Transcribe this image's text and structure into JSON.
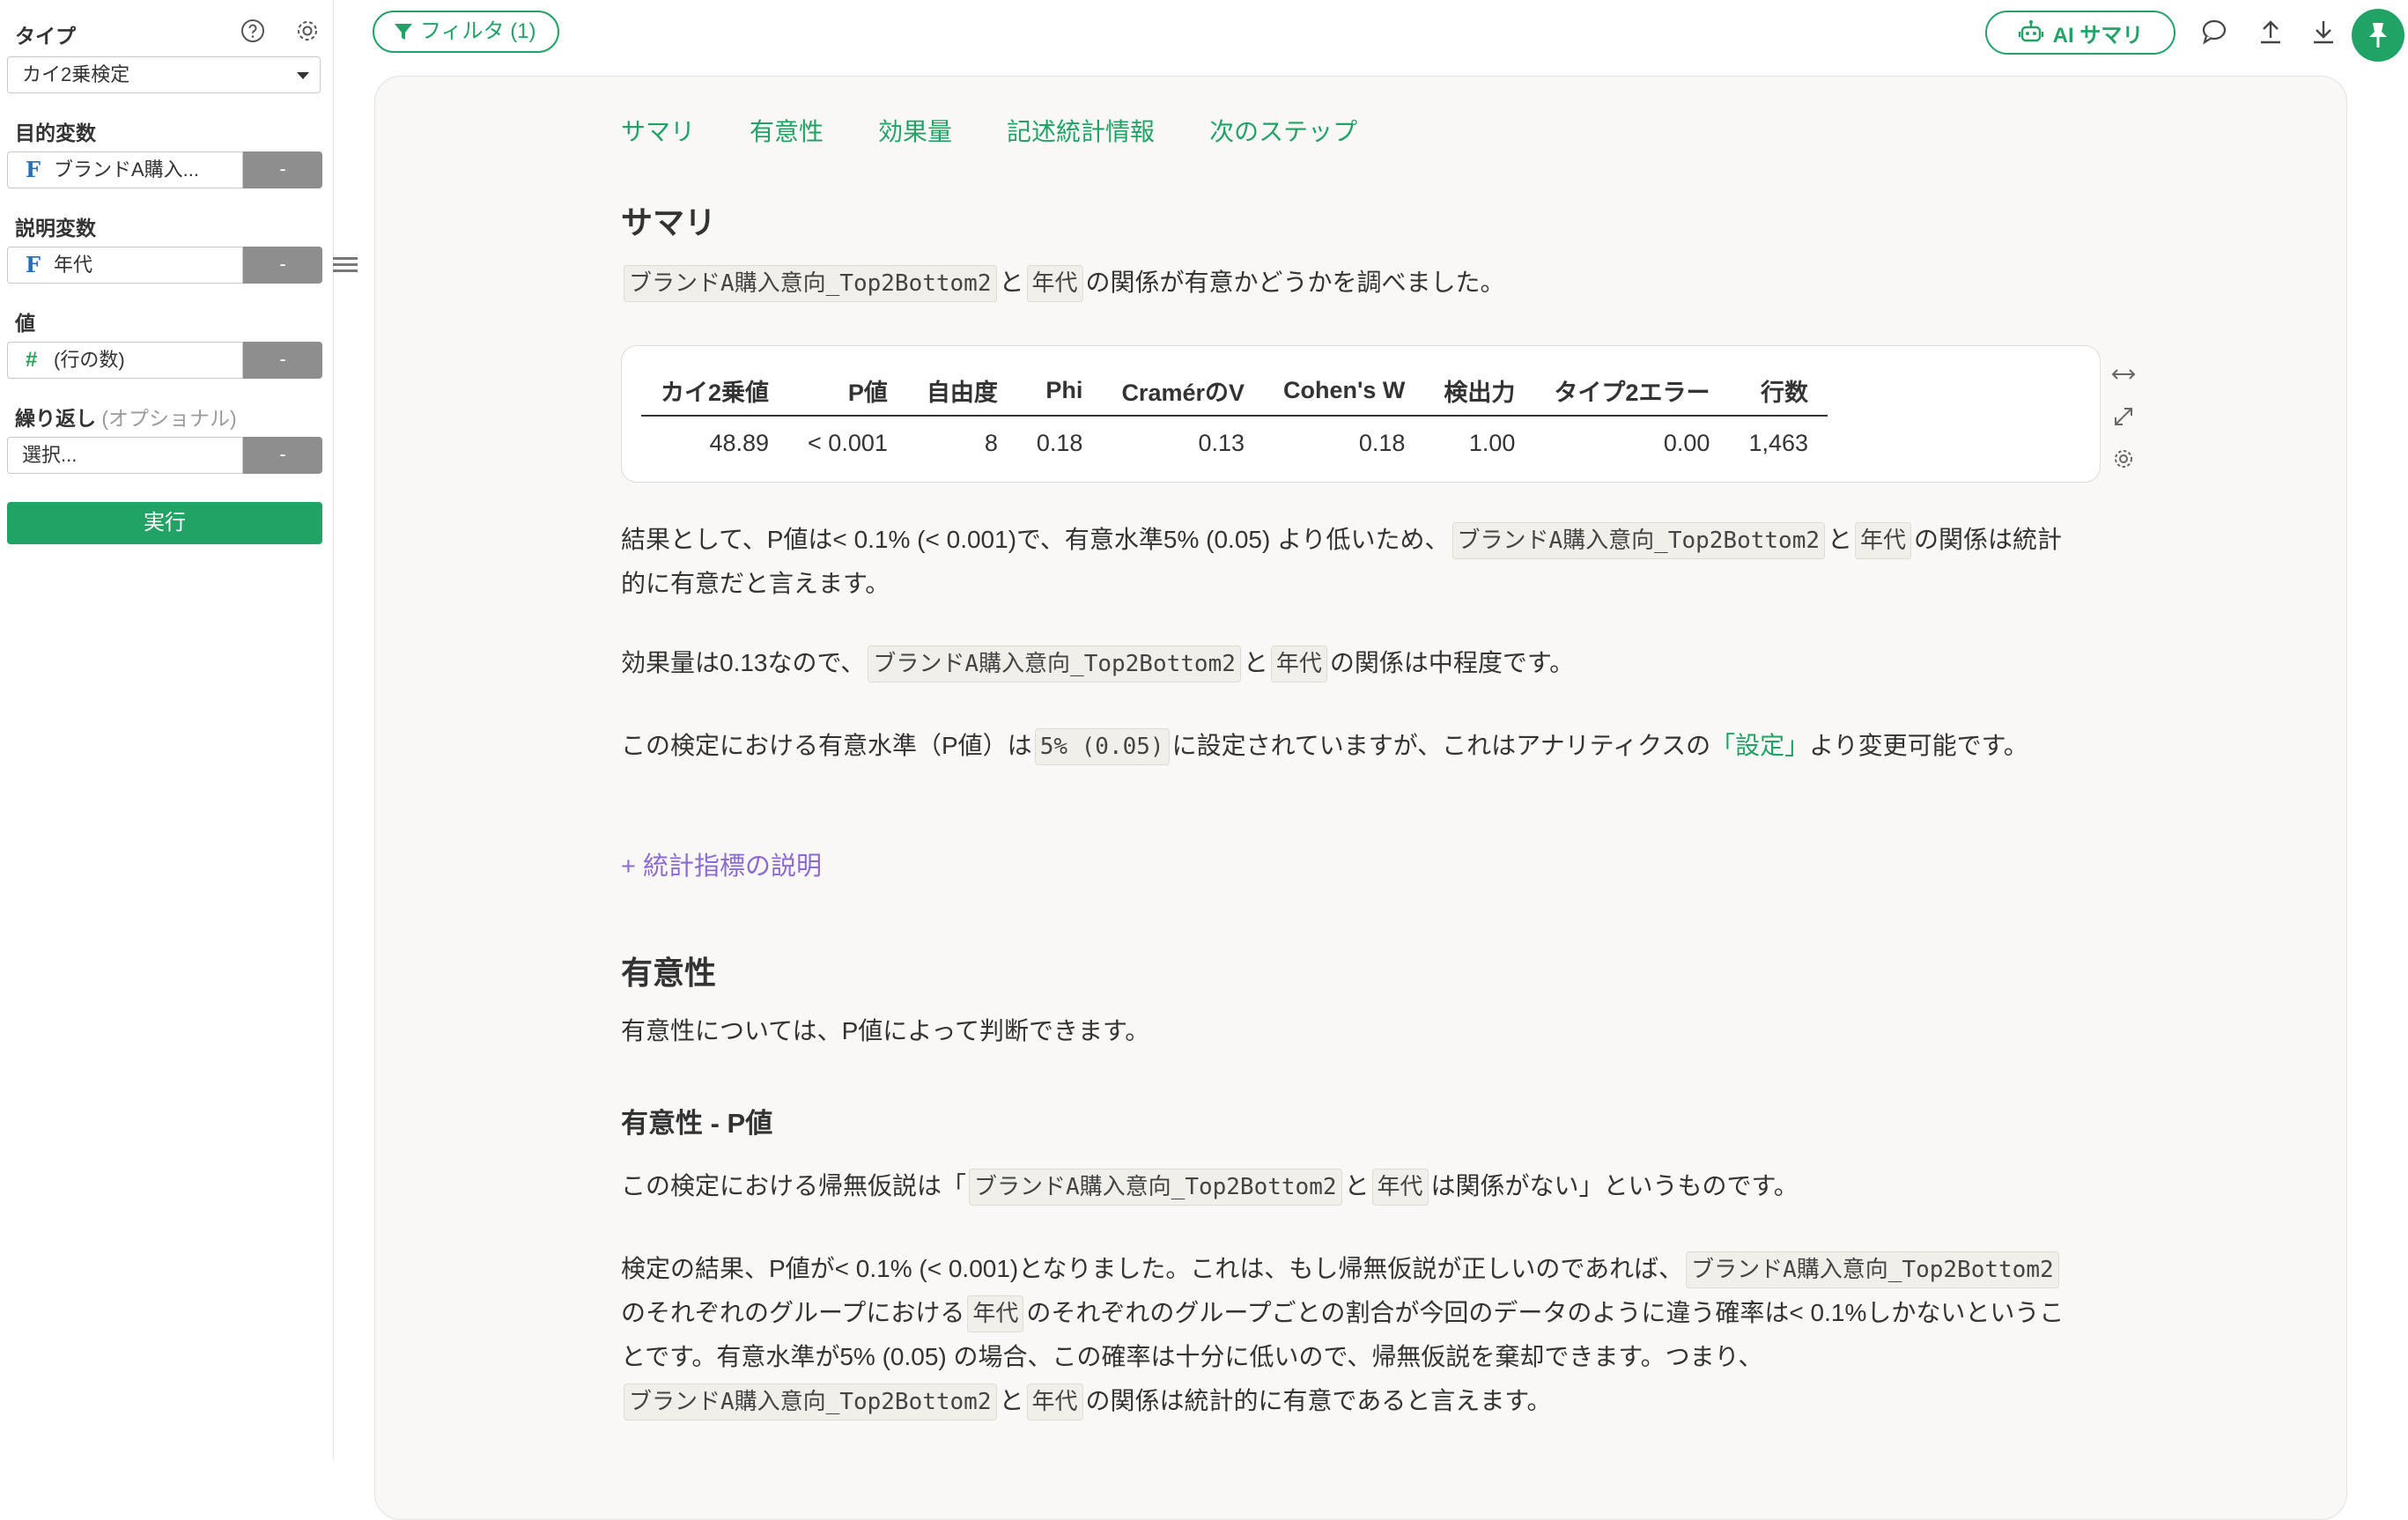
{
  "sidebar": {
    "type_label": "タイプ",
    "type_value": "カイ2乗検定",
    "target_label": "目的変数",
    "target_value": "ブランドA購入...",
    "explanatory_label": "説明変数",
    "explanatory_value": "年代",
    "value_label": "値",
    "value_value": "(行の数)",
    "repeat_label": "繰り返し",
    "repeat_optional": "(オプショナル)",
    "repeat_placeholder": "選択...",
    "minus": "-",
    "run_label": "実行",
    "icons": {
      "help": "help-circle-icon",
      "settings": "gear-icon",
      "menu": "hamburger-icon"
    }
  },
  "topbar": {
    "filter_label": "フィルタ (1)",
    "ai_label": "AI サマリ",
    "icons": [
      "comment-icon",
      "upload-icon",
      "download-icon",
      "pin-icon"
    ]
  },
  "tabs": [
    "サマリ",
    "有意性",
    "効果量",
    "記述統計情報",
    "次のステップ"
  ],
  "summary": {
    "heading": "サマリ",
    "var_target": "ブランドA購入意向_Top2Bottom2",
    "var_group": "年代",
    "t_and": "と",
    "intro_tail": "の関係が有意かどうかを調べました。",
    "table": {
      "headers": [
        "カイ2乗値",
        "P値",
        "自由度",
        "Phi",
        "CramérのV",
        "Cohen's W",
        "検出力",
        "タイプ2エラー",
        "行数"
      ],
      "row": [
        "48.89",
        "< 0.001",
        "8",
        "0.18",
        "0.13",
        "0.18",
        "1.00",
        "0.00",
        "1,463"
      ]
    },
    "p1_a": "結果として、P値は< 0.1% (< 0.001)で、有意水準5% (0.05) より低いため、",
    "p1_b": "の関係は統計的に有意だと言えます。",
    "p2_a": "効果量は0.13なので、",
    "p2_b": "の関係は中程度です。",
    "p3_a": "この検定における有意水準（P値）は",
    "p3_code": "5% (0.05)",
    "p3_b": "に設定されていますが、これはアナリティクスの",
    "p3_link": "「設定」",
    "p3_c": "より変更可能です。",
    "expand_label": "+ 統計指標の説明"
  },
  "significance": {
    "heading": "有意性",
    "intro": "有意性については、P値によって判断できます。",
    "sub_heading": "有意性 - P値",
    "null_a": "この検定における帰無仮説は「",
    "null_b": "は関係がない」というものです。",
    "res_a": "検定の結果、P値が< 0.1% (< 0.001)となりました。これは、もし帰無仮説が正しいのであれば、",
    "res_b": "のそれぞれのグループにおける",
    "res_c": "のそれぞれのグループごとの割合が今回のデータのように違う確率は< 0.1%しかないということです。有意水準が5% (0.05) の場合、この確率は十分に低いので、帰無仮説を棄却できます。つまり、",
    "res_d": "の関係は統計的に有意であると言えます。"
  },
  "colors": {
    "accent": "#22a366",
    "link_purple": "#8c6ad6",
    "field_icon_blue": "#2a6ebb"
  }
}
